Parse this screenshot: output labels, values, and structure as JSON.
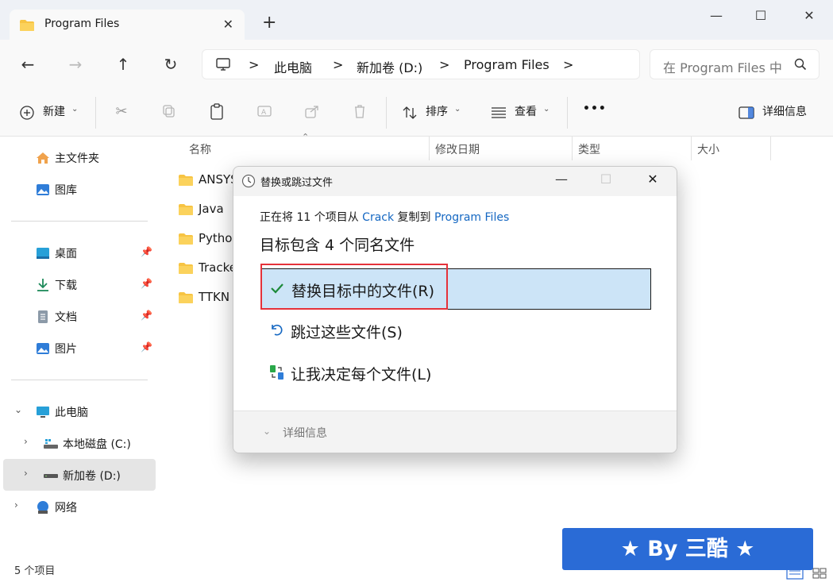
{
  "window": {
    "tab_title": "Program Files",
    "new_tab": "+",
    "minimize": "—",
    "maximize": "☐",
    "close": "✕"
  },
  "nav": {
    "back": "←",
    "forward": "→",
    "up": "↑",
    "refresh": "↻"
  },
  "address": {
    "segments": [
      "此电脑",
      "新加卷 (D:)",
      "Program Files"
    ],
    "separator": ">"
  },
  "search": {
    "placeholder": "在 Program Files 中"
  },
  "toolbar": {
    "new_label": "新建",
    "sort_label": "排序",
    "view_label": "查看",
    "more_label": "•••",
    "details_label": "详细信息"
  },
  "sidebar": {
    "items": [
      {
        "label": "主文件夹",
        "icon": "home-icon"
      },
      {
        "label": "图库",
        "icon": "gallery-icon"
      },
      {
        "label": "桌面",
        "icon": "desktop-icon"
      },
      {
        "label": "下载",
        "icon": "download-icon"
      },
      {
        "label": "文档",
        "icon": "document-icon"
      },
      {
        "label": "图片",
        "icon": "pictures-icon"
      },
      {
        "label": "此电脑",
        "icon": "computer-icon"
      },
      {
        "label": "本地磁盘 (C:)",
        "icon": "drive-icon"
      },
      {
        "label": "新加卷 (D:)",
        "icon": "drive-icon"
      },
      {
        "label": "网络",
        "icon": "network-icon"
      }
    ]
  },
  "columns": [
    "名称",
    "修改日期",
    "类型",
    "大小"
  ],
  "files": [
    "ANSYS",
    "Java",
    "Python",
    "Tracke",
    "TTKN"
  ],
  "status": {
    "item_count": "5 个项目"
  },
  "dialog": {
    "title": "替换或跳过文件",
    "progress_prefix": "正在将 11 个项目从 ",
    "source": "Crack",
    "progress_middle": " 复制到 ",
    "destination": "Program Files",
    "heading": "目标包含 4 个同名文件",
    "option_replace": "替换目标中的文件(R)",
    "option_skip": "跳过这些文件(S)",
    "option_decide": "让我决定每个文件(L)",
    "more_details": "详细信息"
  },
  "watermark": {
    "text": "★ By 三酷 ★"
  },
  "colors": {
    "accent": "#1467c2",
    "selection_bg": "#cce4f7",
    "highlight_border": "#e5323a",
    "folder": "#f7c443",
    "watermark_bg": "#2a6bd6"
  }
}
